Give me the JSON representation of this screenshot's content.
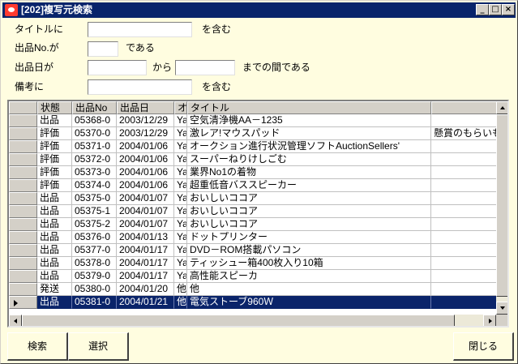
{
  "window": {
    "title": "[202]複写元検索",
    "controls": {
      "minimize": "_",
      "maximize": "□",
      "close": "×"
    }
  },
  "form": {
    "title_label": "タイトルに",
    "title_suffix": "を含む",
    "title_value": "",
    "item_no_label": "出品No.が",
    "item_no_suffix": "である",
    "item_no_value": "",
    "date_label": "出品日が",
    "date_from_suffix": "から",
    "date_to_suffix": "までの間である",
    "date_from_value": "",
    "date_to_value": "",
    "remarks_label": "備考に",
    "remarks_suffix": "を含む",
    "remarks_value": ""
  },
  "grid": {
    "columns": [
      "状態",
      "出品No",
      "出品日",
      "オ",
      "タイトル",
      ""
    ],
    "rows": [
      [
        "出品",
        "05368-0",
        "2003/12/29",
        "Ya",
        "空気清浄機AA－1235",
        ""
      ],
      [
        "評価",
        "05370-0",
        "2003/12/29",
        "Ya",
        "激レア!マウスパッド",
        "懸賞のもらいもの"
      ],
      [
        "評価",
        "05371-0",
        "2004/01/06",
        "Ya",
        "オークション進行状況管理ソフトAuctionSellers'",
        ""
      ],
      [
        "評価",
        "05372-0",
        "2004/01/06",
        "Ya",
        "スーパーねりけしごむ",
        ""
      ],
      [
        "評価",
        "05373-0",
        "2004/01/06",
        "Ya",
        "業界No1の着物",
        ""
      ],
      [
        "評価",
        "05374-0",
        "2004/01/06",
        "Ya",
        "超重低音バススピーカー",
        ""
      ],
      [
        "出品",
        "05375-0",
        "2004/01/07",
        "Ya",
        "おいしいココア",
        ""
      ],
      [
        "出品",
        "05375-1",
        "2004/01/07",
        "Ya",
        "おいしいココア",
        ""
      ],
      [
        "出品",
        "05375-2",
        "2004/01/07",
        "Ya",
        "おいしいココア",
        ""
      ],
      [
        "出品",
        "05376-0",
        "2004/01/13",
        "Ya",
        "ドットプリンター",
        ""
      ],
      [
        "出品",
        "05377-0",
        "2004/01/17",
        "Ya",
        "DVD－ROM搭載パソコン",
        ""
      ],
      [
        "出品",
        "05378-0",
        "2004/01/17",
        "Ya",
        "ティッシュー箱400枚入り10箱",
        ""
      ],
      [
        "出品",
        "05379-0",
        "2004/01/17",
        "Ya",
        "高性能スピーカ",
        ""
      ],
      [
        "発送",
        "05380-0",
        "2004/01/20",
        "他",
        "他",
        ""
      ],
      [
        "出品",
        "05381-0",
        "2004/01/21",
        "他",
        "電気ストーブ960Ｗ",
        ""
      ]
    ],
    "selected_row": 14
  },
  "buttons": {
    "search": "検索",
    "select": "選択",
    "close": "閉じる"
  },
  "colors": {
    "title_bar": "#08246b",
    "window_bg": "#fffde0",
    "selection": "#0a246a"
  }
}
